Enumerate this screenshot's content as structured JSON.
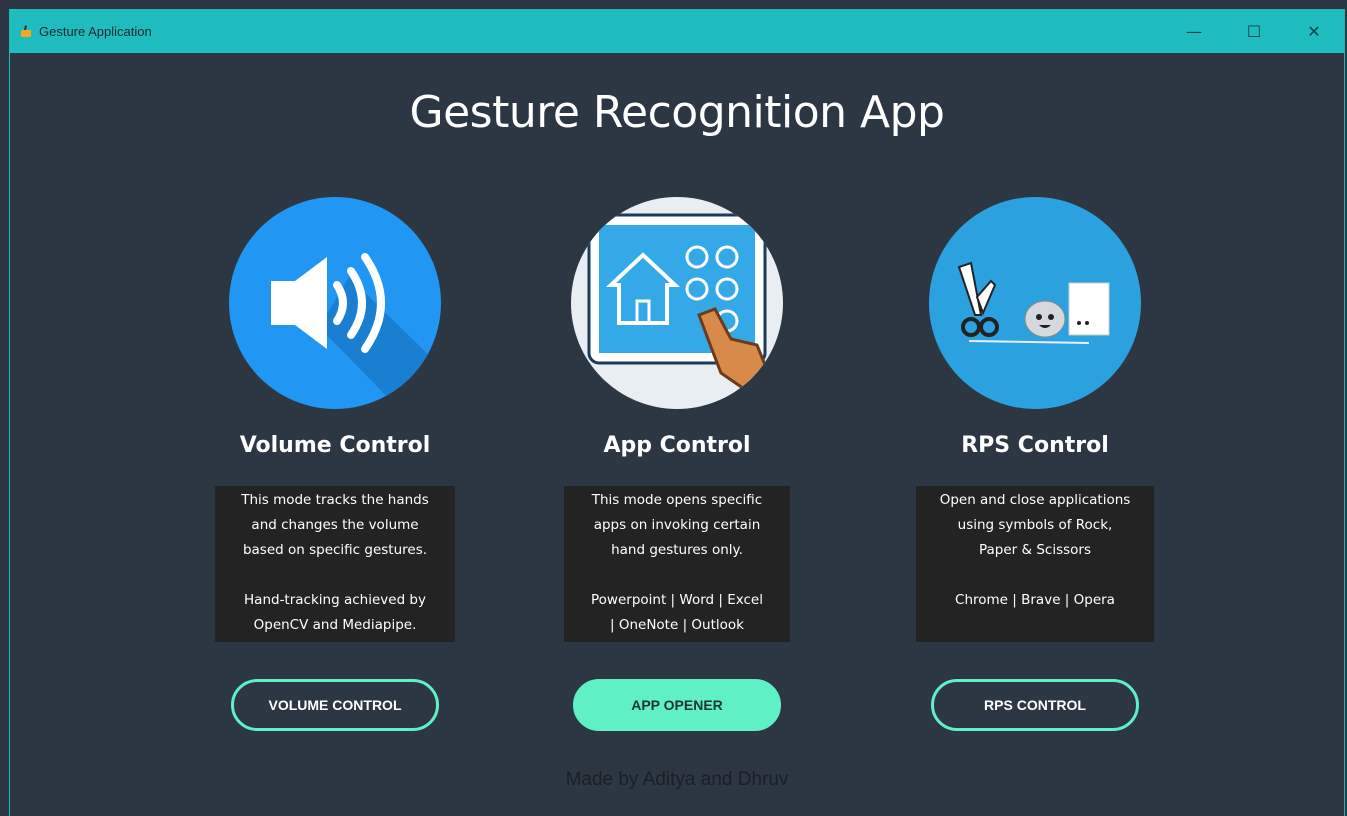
{
  "window": {
    "title": "Gesture Application",
    "controls": {
      "minimize": "—",
      "maximize": "☐",
      "close": "✕"
    }
  },
  "main": {
    "title": "Gesture Recognition App",
    "cards": [
      {
        "heading": "Volume Control",
        "icon": "speaker-icon",
        "desc_lines": [
          "This mode tracks the hands",
          "and changes the volume",
          "based on specific gestures."
        ],
        "desc_extra": [
          "Hand-tracking achieved by",
          "OpenCV and Mediapipe."
        ],
        "button": "VOLUME CONTROL"
      },
      {
        "heading": "App Control",
        "icon": "tablet-touch-icon",
        "desc_lines": [
          "This mode opens specific",
          "apps on invoking certain",
          "hand gestures only."
        ],
        "desc_extra": [
          "Powerpoint | Word | Excel",
          "| OneNote | Outlook"
        ],
        "button": "APP OPENER"
      },
      {
        "heading": "RPS Control",
        "icon": "rock-paper-scissors-icon",
        "desc_lines": [
          "Open and close applications",
          "using symbols of  Rock,",
          "Paper & Scissors"
        ],
        "desc_extra": [
          "Chrome | Brave | Opera"
        ],
        "button": "RPS CONTROL"
      }
    ]
  },
  "footer": {
    "text": "Made by Aditya and Dhruv"
  },
  "colors": {
    "background": "#2d3743",
    "titlebar": "#1ebcbe",
    "accent": "#5ff0c6",
    "desc_bg": "#232323"
  }
}
